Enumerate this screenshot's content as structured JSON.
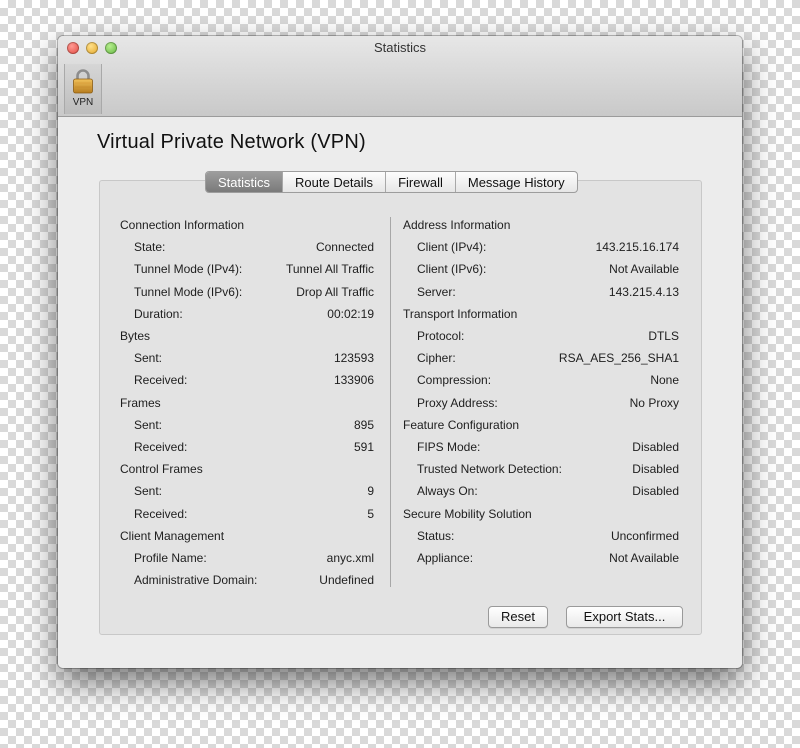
{
  "window": {
    "title": "Statistics"
  },
  "toolbar": {
    "vpn_label": "VPN"
  },
  "page": {
    "title": "Virtual Private Network (VPN)"
  },
  "tabs": [
    {
      "label": "Statistics",
      "active": true
    },
    {
      "label": "Route Details",
      "active": false
    },
    {
      "label": "Firewall",
      "active": false
    },
    {
      "label": "Message History",
      "active": false
    }
  ],
  "left": [
    {
      "type": "section",
      "label": "Connection Information"
    },
    {
      "type": "item",
      "label": "State:",
      "value": "Connected"
    },
    {
      "type": "item",
      "label": "Tunnel Mode (IPv4):",
      "value": "Tunnel All Traffic"
    },
    {
      "type": "item",
      "label": "Tunnel Mode (IPv6):",
      "value": "Drop All Traffic"
    },
    {
      "type": "item",
      "label": "Duration:",
      "value": "00:02:19"
    },
    {
      "type": "section",
      "label": "Bytes"
    },
    {
      "type": "item",
      "label": "Sent:",
      "value": "123593"
    },
    {
      "type": "item",
      "label": "Received:",
      "value": "133906"
    },
    {
      "type": "section",
      "label": "Frames"
    },
    {
      "type": "item",
      "label": "Sent:",
      "value": "895"
    },
    {
      "type": "item",
      "label": "Received:",
      "value": "591"
    },
    {
      "type": "section",
      "label": "Control Frames"
    },
    {
      "type": "item",
      "label": "Sent:",
      "value": "9"
    },
    {
      "type": "item",
      "label": "Received:",
      "value": "5"
    },
    {
      "type": "section",
      "label": "Client Management"
    },
    {
      "type": "item",
      "label": "Profile Name:",
      "value": "anyc.xml"
    },
    {
      "type": "item",
      "label": "Administrative Domain:",
      "value": "Undefined"
    }
  ],
  "right": [
    {
      "type": "section",
      "label": "Address Information"
    },
    {
      "type": "item",
      "label": "Client (IPv4):",
      "value": "143.215.16.174"
    },
    {
      "type": "item",
      "label": "Client (IPv6):",
      "value": "Not Available"
    },
    {
      "type": "item",
      "label": "Server:",
      "value": "143.215.4.13"
    },
    {
      "type": "section",
      "label": "Transport Information"
    },
    {
      "type": "item",
      "label": "Protocol:",
      "value": "DTLS"
    },
    {
      "type": "item",
      "label": "Cipher:",
      "value": "RSA_AES_256_SHA1"
    },
    {
      "type": "item",
      "label": "Compression:",
      "value": "None"
    },
    {
      "type": "item",
      "label": "Proxy Address:",
      "value": "No Proxy"
    },
    {
      "type": "section",
      "label": "Feature Configuration"
    },
    {
      "type": "item",
      "label": "FIPS Mode:",
      "value": "Disabled"
    },
    {
      "type": "item",
      "label": "Trusted Network Detection:",
      "value": "Disabled"
    },
    {
      "type": "item",
      "label": "Always On:",
      "value": "Disabled"
    },
    {
      "type": "section",
      "label": "Secure Mobility Solution"
    },
    {
      "type": "item",
      "label": "Status:",
      "value": "Unconfirmed"
    },
    {
      "type": "item",
      "label": "Appliance:",
      "value": "Not Available"
    }
  ],
  "buttons": {
    "reset": "Reset",
    "export": "Export Stats..."
  },
  "icons": {
    "vpn": "lock-icon"
  },
  "colors": {
    "active_tab": "#8a8a8a",
    "window_bg": "#ececec",
    "panel_bg": "#e3e3e3"
  }
}
